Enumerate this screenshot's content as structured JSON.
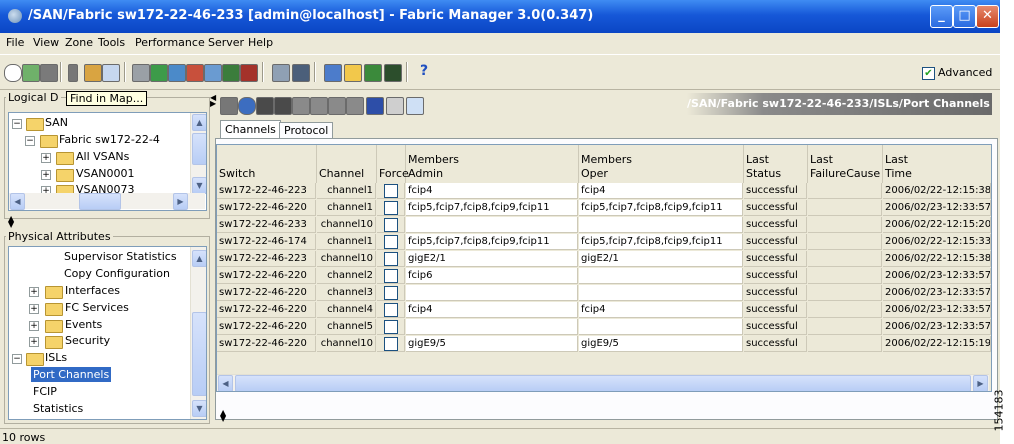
{
  "window": {
    "title": "/SAN/Fabric sw172-22-46-233 [admin@localhost] - Fabric Manager 3.0(0.347)"
  },
  "menu": [
    "File",
    "View",
    "Zone",
    "Tools",
    "Performance",
    "Server",
    "Help"
  ],
  "toolbar": {
    "advanced_label": "Advanced",
    "advanced_checked": true
  },
  "logical_panel": {
    "label": "Logical D",
    "tooltip": "Find in Map...",
    "tree": [
      {
        "label": "SAN",
        "level": 0,
        "expanded": true
      },
      {
        "label": "Fabric sw172-22-4",
        "level": 1,
        "expanded": true
      },
      {
        "label": "All VSANs",
        "level": 2,
        "expanded": false
      },
      {
        "label": "VSAN0001",
        "level": 2,
        "expanded": false
      },
      {
        "label": "VSAN0073",
        "level": 2,
        "expanded": false
      }
    ]
  },
  "physical_panel": {
    "label": "Physical Attributes",
    "tree": [
      {
        "label": "Supervisor Statistics",
        "level": 1
      },
      {
        "label": "Copy Configuration",
        "level": 1
      },
      {
        "label": "Interfaces",
        "level": 1,
        "folder": true
      },
      {
        "label": "FC Services",
        "level": 1,
        "folder": true
      },
      {
        "label": "Events",
        "level": 1,
        "folder": true
      },
      {
        "label": "Security",
        "level": 1,
        "folder": true
      },
      {
        "label": "ISLs",
        "level": 0,
        "folder": true,
        "expanded": true
      },
      {
        "label": "Port Channels",
        "level": 1,
        "selected": true
      },
      {
        "label": "FCIP",
        "level": 1
      },
      {
        "label": "Statistics",
        "level": 1
      }
    ]
  },
  "content": {
    "path": "/SAN/Fabric sw172-22-46-233/ISLs/Port Channels",
    "tabs": [
      "Channels",
      "Protocol"
    ],
    "active_tab": "Channels"
  },
  "table": {
    "headers": [
      {
        "line1": "",
        "line2": "Switch"
      },
      {
        "line1": "",
        "line2": "Channel"
      },
      {
        "line1": "",
        "line2": "Force"
      },
      {
        "line1": "Members",
        "line2": "Admin"
      },
      {
        "line1": "Members",
        "line2": "Oper"
      },
      {
        "line1": "Last",
        "line2": "Status"
      },
      {
        "line1": "Last",
        "line2": "FailureCause"
      },
      {
        "line1": "Last",
        "line2": "Time"
      }
    ],
    "rows": [
      [
        "sw172-22-46-223",
        "channel1",
        "",
        "fcip4",
        "fcip4",
        "successful",
        "",
        "2006/02/22-12:15:38"
      ],
      [
        "sw172-22-46-220",
        "channel1",
        "",
        "fcip5,fcip7,fcip8,fcip9,fcip11",
        "fcip5,fcip7,fcip8,fcip9,fcip11",
        "successful",
        "",
        "2006/02/23-12:33:57"
      ],
      [
        "sw172-22-46-233",
        "channel10",
        "",
        "",
        "",
        "successful",
        "",
        "2006/02/22-12:15:20"
      ],
      [
        "sw172-22-46-174",
        "channel1",
        "",
        "fcip5,fcip7,fcip8,fcip9,fcip11",
        "fcip5,fcip7,fcip8,fcip9,fcip11",
        "successful",
        "",
        "2006/02/22-12:15:33"
      ],
      [
        "sw172-22-46-223",
        "channel10",
        "",
        "gigE2/1",
        "gigE2/1",
        "successful",
        "",
        "2006/02/22-12:15:38"
      ],
      [
        "sw172-22-46-220",
        "channel2",
        "",
        "fcip6",
        "",
        "successful",
        "",
        "2006/02/23-12:33:57"
      ],
      [
        "sw172-22-46-220",
        "channel3",
        "",
        "",
        "",
        "successful",
        "",
        "2006/02/23-12:33:57"
      ],
      [
        "sw172-22-46-220",
        "channel4",
        "",
        "fcip4",
        "fcip4",
        "successful",
        "",
        "2006/02/23-12:33:57"
      ],
      [
        "sw172-22-46-220",
        "channel5",
        "",
        "",
        "",
        "successful",
        "",
        "2006/02/23-12:33:57"
      ],
      [
        "sw172-22-46-220",
        "channel10",
        "",
        "gigE9/5",
        "gigE9/5",
        "successful",
        "",
        "2006/02/22-12:15:19"
      ]
    ]
  },
  "status": {
    "rows_text": "10 rows"
  },
  "figure_id": "154183"
}
